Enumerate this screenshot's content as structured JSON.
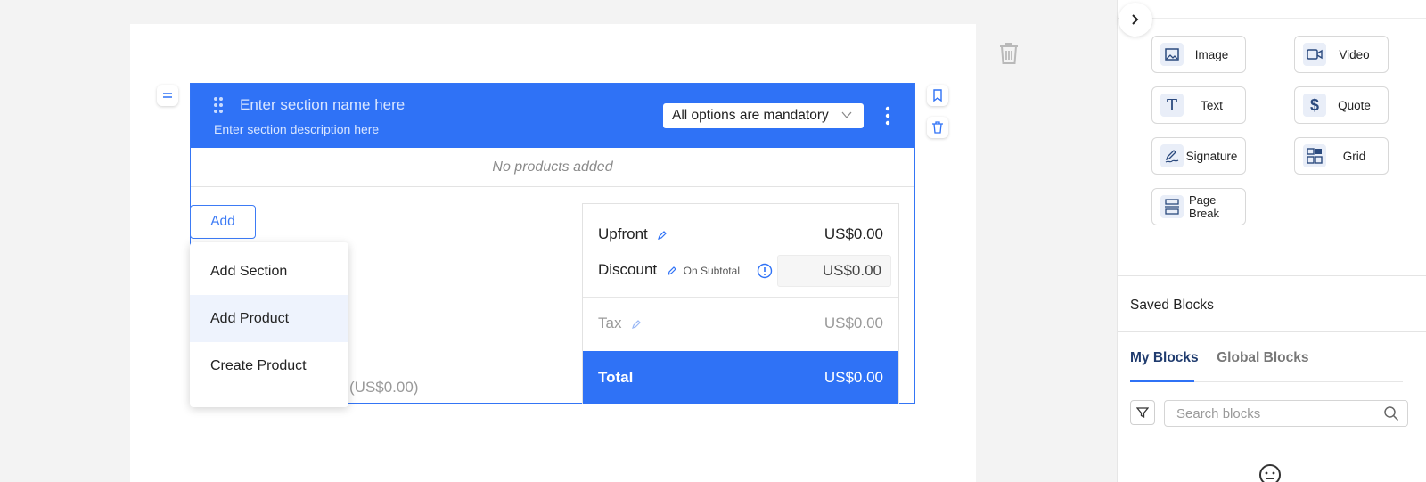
{
  "section": {
    "name_placeholder": "Enter section name here",
    "description_placeholder": "Enter section description here",
    "options_select": "All options are mandatory",
    "empty_text": "No products added"
  },
  "add_button": "Add",
  "add_menu": {
    "items": [
      {
        "label": "Add Section"
      },
      {
        "label": "Add Product"
      },
      {
        "label": "Create Product"
      }
    ]
  },
  "subtotal_ghost": "(US$0.00)",
  "summary": {
    "upfront_label": "Upfront",
    "upfront_value": "US$0.00",
    "discount_label": "Discount",
    "discount_basis": "On Subtotal",
    "discount_value": "US$0.00",
    "tax_label": "Tax",
    "tax_value": "US$0.00",
    "total_label": "Total",
    "total_value": "US$0.00"
  },
  "blocks_panel": {
    "blocks": [
      {
        "label": "Image",
        "icon": "image-icon"
      },
      {
        "label": "Video",
        "icon": "video-icon"
      },
      {
        "label": "Text",
        "icon": "text-icon"
      },
      {
        "label": "Quote",
        "icon": "dollar-icon"
      },
      {
        "label": "Signature",
        "icon": "signature-icon"
      },
      {
        "label": "Grid",
        "icon": "grid-icon"
      },
      {
        "label": "Page Break",
        "icon": "page-break-icon"
      }
    ],
    "saved_blocks_title": "Saved Blocks",
    "tabs": [
      {
        "label": "My Blocks",
        "active": true
      },
      {
        "label": "Global Blocks",
        "active": false
      }
    ],
    "search_placeholder": "Search blocks"
  },
  "colors": {
    "accent": "#2f72f6",
    "icon_bg": "#e9eef8",
    "icon_fg": "#2b4a7e"
  }
}
